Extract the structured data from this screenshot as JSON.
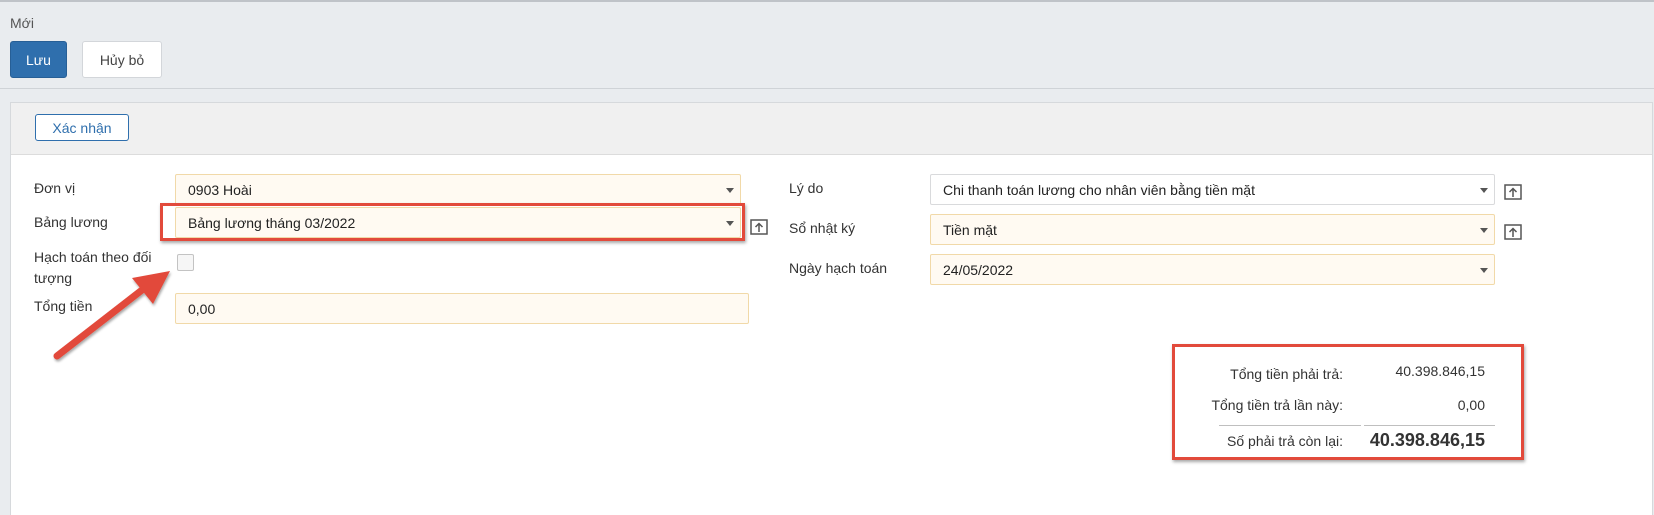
{
  "header": {
    "page_title": "Mới",
    "save_label": "Lưu",
    "cancel_label": "Hủy bỏ"
  },
  "toolbar": {
    "confirm_label": "Xác nhận"
  },
  "form_left": {
    "don_vi_label": "Đơn vị",
    "don_vi_value": "0903 Hoài",
    "bang_luong_label": "Bảng lương",
    "bang_luong_value": "Bảng lương tháng 03/2022",
    "hach_toan_label_line1": "Hạch toán theo đối",
    "hach_toan_label_line2": "tượng",
    "hach_toan_checked": false,
    "tong_tien_label": "Tổng tiền",
    "tong_tien_value": "0,00"
  },
  "form_right": {
    "ly_do_label": "Lý do",
    "ly_do_value": "Chi thanh toán lương cho nhân viên bằng tiền mặt",
    "so_nhat_ky_label": "Sổ nhật ký",
    "so_nhat_ky_value": "Tiền mặt",
    "ngay_hach_toan_label": "Ngày hạch toán",
    "ngay_hach_toan_value": "24/05/2022"
  },
  "summary": {
    "tong_phai_tra_label": "Tổng tiền phải trả:",
    "tong_phai_tra_value": "40.398.846,15",
    "tra_lan_nay_label": "Tổng tiền trả lần này:",
    "tra_lan_nay_value": "0,00",
    "con_lai_label": "Số phải trả còn lại:",
    "con_lai_value": "40.398.846,15"
  },
  "icons": {
    "upload": "open-list-icon",
    "dropdown": "chevron-down-icon",
    "annotation": "red-arrow-icon"
  },
  "colors": {
    "primary": "#2f6fad",
    "field_bg": "#fffaf2",
    "field_border": "#f1d9a8",
    "annotation_red": "#e24a3b"
  }
}
